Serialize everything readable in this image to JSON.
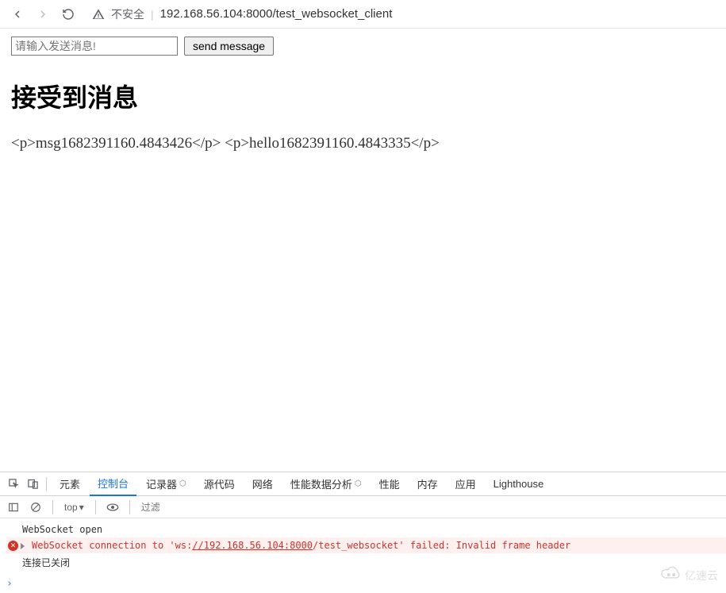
{
  "browser": {
    "security_label": "不安全",
    "url": "192.168.56.104:8000/test_websocket_client"
  },
  "form": {
    "placeholder": "请输入发送消息!",
    "value": "",
    "send_label": "send message"
  },
  "page": {
    "heading": "接受到消息",
    "received_text": "<p>msg1682391160.4843426</p> <p>hello1682391160.4843335</p>"
  },
  "devtools": {
    "tabs": {
      "elements": "元素",
      "console": "控制台",
      "recorder": "记录器",
      "sources": "源代码",
      "network": "网络",
      "performance_insights": "性能数据分析",
      "performance": "性能",
      "memory": "内存",
      "application": "应用",
      "lighthouse": "Lighthouse"
    },
    "toolbar": {
      "context": "top",
      "filter_placeholder": "过滤"
    },
    "console": {
      "line1": "WebSocket open",
      "error_prefix": "WebSocket connection to '",
      "error_url_scheme": "ws:",
      "error_url_host": "//192.168.56.104:8000",
      "error_url_path": "/test_websocket' ",
      "error_suffix": "failed: Invalid frame header",
      "line3": "连接已关闭"
    }
  },
  "watermark": "亿速云"
}
